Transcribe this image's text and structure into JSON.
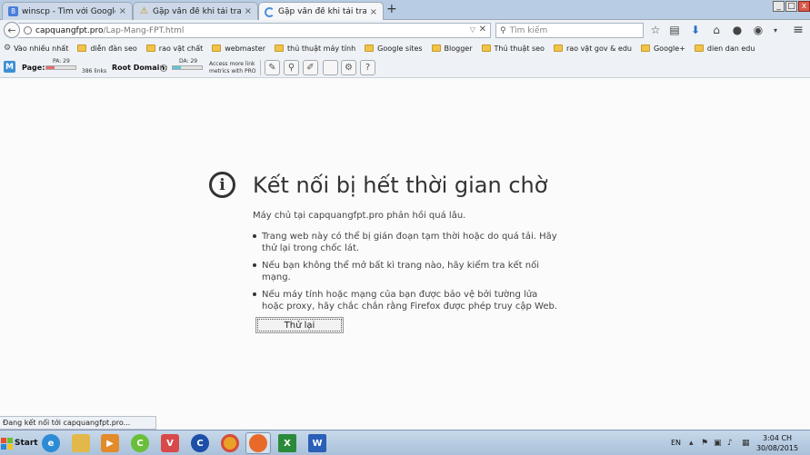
{
  "tabs": [
    {
      "label": "winscp - Tìm với Google",
      "icon": "google-icon"
    },
    {
      "label": "Gặp vấn đề khi tải trang",
      "icon": "warning-icon"
    },
    {
      "label": "Gặp vấn đề khi tải trang",
      "icon": "loading-icon"
    }
  ],
  "window_controls": {
    "minimize": "_",
    "maximize": "□",
    "close": "x"
  },
  "address": {
    "host": "capquangfpt.pro",
    "path": "/Lap-Mang-FPT.html"
  },
  "search": {
    "placeholder": "Tìm kiếm"
  },
  "bookmarks": [
    "Vào nhiều nhất",
    "diễn đàn seo",
    "rao vặt chất",
    "webmaster",
    "thủ thuật máy tính",
    "Google sites",
    "Blogger",
    "Thủ thuật seo",
    "rao vặt gov & edu",
    "Google+",
    "dien dan edu"
  ],
  "moz": {
    "logo": "M",
    "page_label": "Page:",
    "pa": "PA: 29",
    "pa_value": 29,
    "links": "386 links",
    "root_label": "Root Domain:",
    "da": "DA: 29",
    "da_value": 29,
    "pro_line1": "Access more link",
    "pro_line2": "metrics with PRO",
    "colors": {
      "pa": "#e36b6b",
      "da": "#5fc3d6"
    }
  },
  "error": {
    "title": "Kết nối bị hết thời gian chờ",
    "description": "Máy chủ tại capquangfpt.pro phản hồi quá lâu.",
    "bullets": [
      "Trang web này có thể bị gián đoạn tạm thời hoặc do quá tải. Hãy thử lại trong chốc lát.",
      "Nếu bạn không thể mở bất kì trang nào, hãy kiểm tra kết nối mạng.",
      "Nếu máy tính hoặc mạng của bạn được bảo vệ bởi tường lửa hoặc proxy, hãy chắc chắn rằng Firefox được phép truy cập Web."
    ],
    "retry_label": "Thử lại"
  },
  "status": "Đang kết nối tới capquangfpt.pro...",
  "taskbar": {
    "start": "Start",
    "lang": "EN",
    "time": "3:04 CH",
    "date": "30/08/2015"
  }
}
